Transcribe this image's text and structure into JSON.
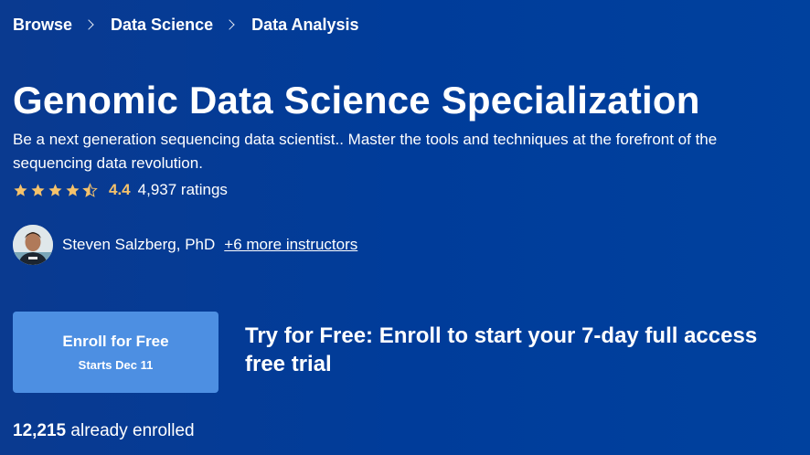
{
  "breadcrumb": {
    "items": [
      "Browse",
      "Data Science",
      "Data Analysis"
    ]
  },
  "course": {
    "title": "Genomic Data Science Specialization",
    "subtitle": "Be a next generation sequencing data scientist.. Master the tools and techniques at the forefront of the sequencing data revolution."
  },
  "rating": {
    "value": "4.4",
    "count_text": "4,937 ratings",
    "stars": 4.5,
    "star_color": "#f5c26b"
  },
  "instructors": {
    "primary": "Steven Salzberg, PhD",
    "more_link": "+6 more instructors"
  },
  "enroll": {
    "label": "Enroll for Free",
    "starts": "Starts Dec 11",
    "button_color": "#4d8fe2"
  },
  "trial": {
    "text": "Try for Free: Enroll to start your 7-day full access free trial"
  },
  "enrollment": {
    "count": "12,215",
    "suffix": " already enrolled"
  },
  "colors": {
    "background": "#00419e",
    "accent": "#f5c26b"
  }
}
